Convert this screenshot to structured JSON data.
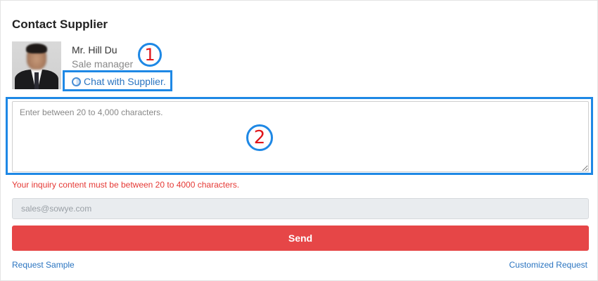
{
  "title": "Contact Supplier",
  "supplier": {
    "name": "Mr. Hill Du",
    "role": "Sale manager",
    "chat_label": "Chat with Supplier."
  },
  "annotations": {
    "marker_1": "1",
    "marker_2": "2"
  },
  "message": {
    "placeholder": "Enter between 20 to 4,000 characters.",
    "value": "",
    "error": "Your inquiry content must be between 20 to 4000 characters."
  },
  "email": {
    "placeholder": "sales@sowye.com"
  },
  "actions": {
    "send_label": "Send",
    "request_sample": "Request Sample",
    "customized_request": "Customized Request"
  },
  "colors": {
    "accent_blue": "#1e88e5",
    "link_blue": "#2a74c0",
    "send_red": "#e64647",
    "error_red": "#e53935",
    "marker_red": "#e0161b"
  }
}
